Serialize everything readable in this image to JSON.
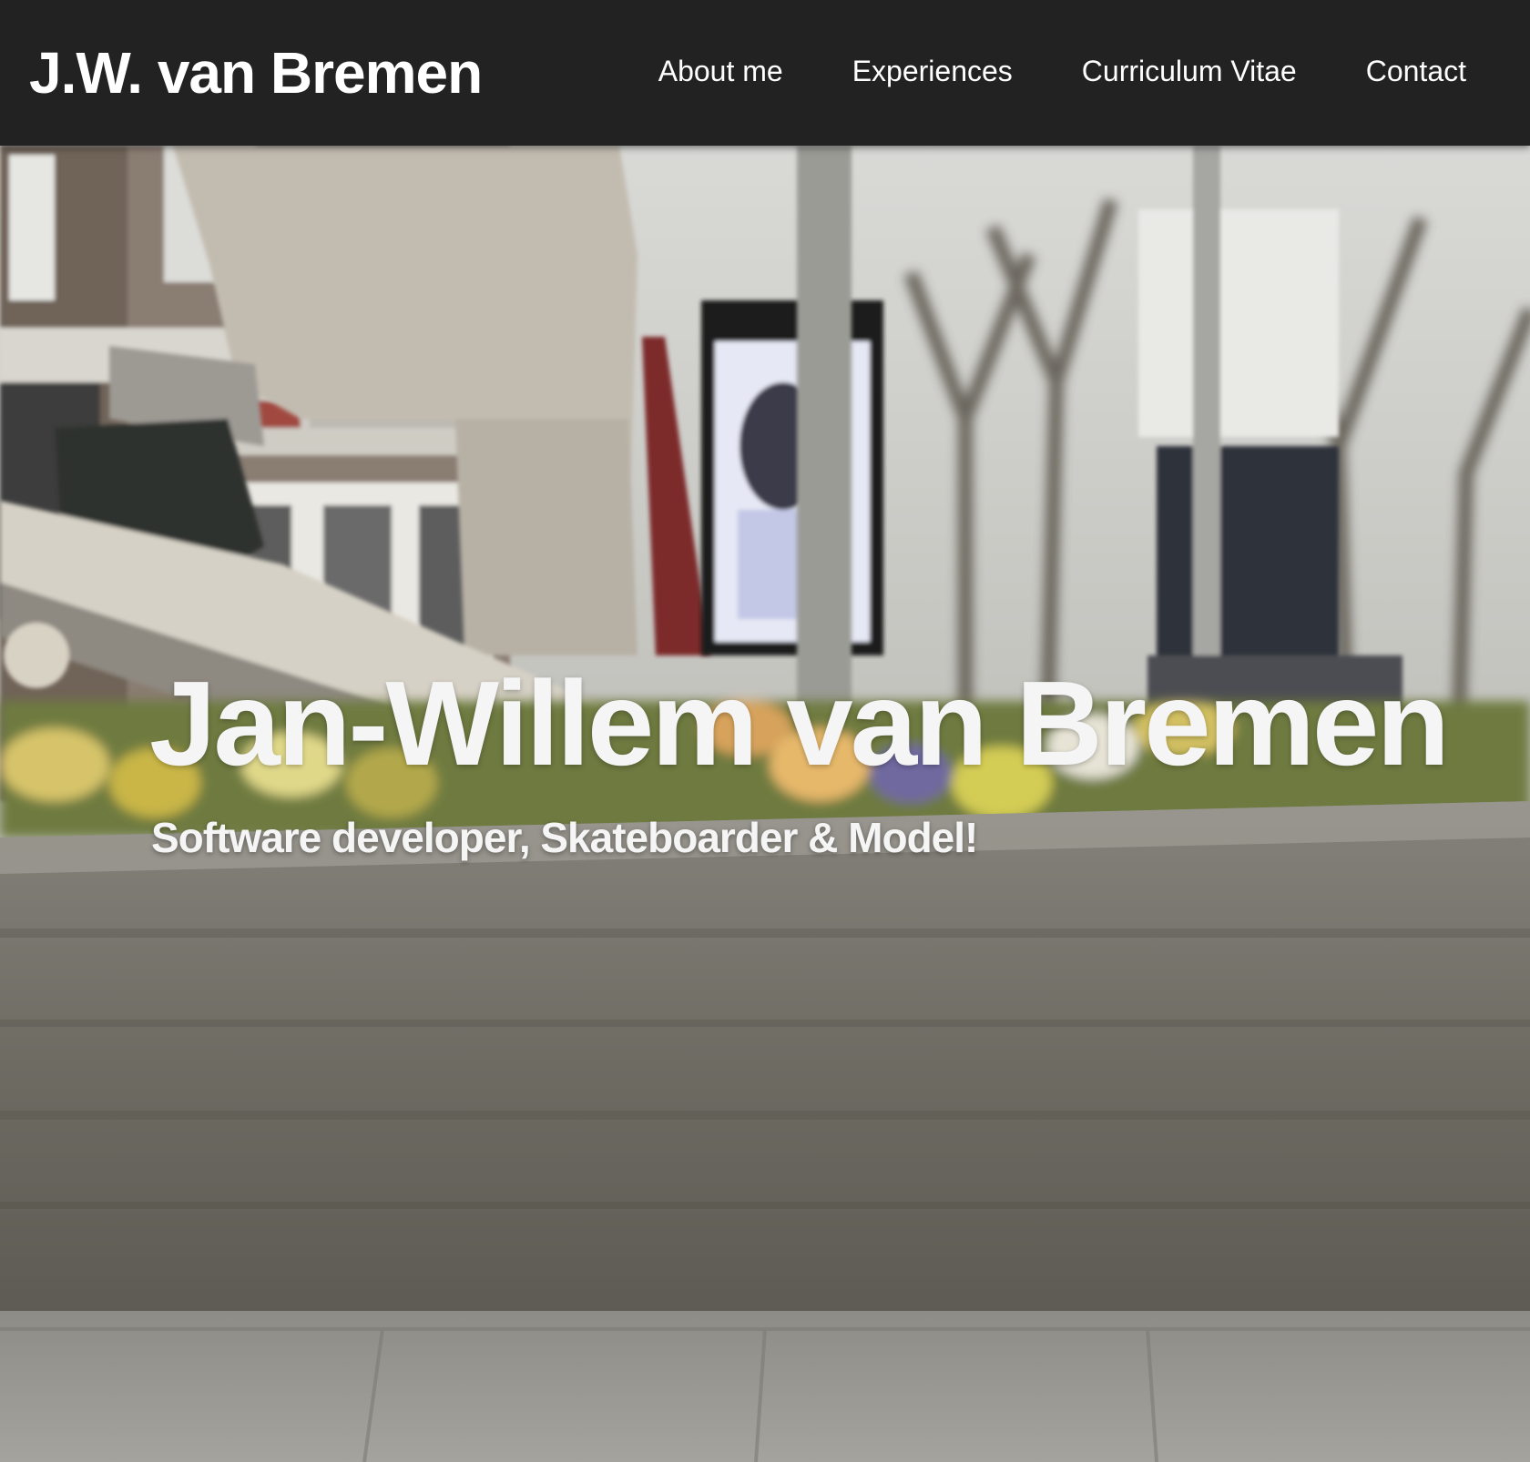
{
  "header": {
    "brand": "J.W. van Bremen",
    "nav": [
      {
        "label": "About me"
      },
      {
        "label": "Experiences"
      },
      {
        "label": "Curriculum Vitae"
      },
      {
        "label": "Contact"
      }
    ]
  },
  "hero": {
    "title": "Jan-Willem van Bremen",
    "subtitle": "Software developer, Skateboarder & Model!",
    "background": "video-still-skateboarding"
  },
  "colors": {
    "navbar": "#222222",
    "text": "#ffffff"
  }
}
